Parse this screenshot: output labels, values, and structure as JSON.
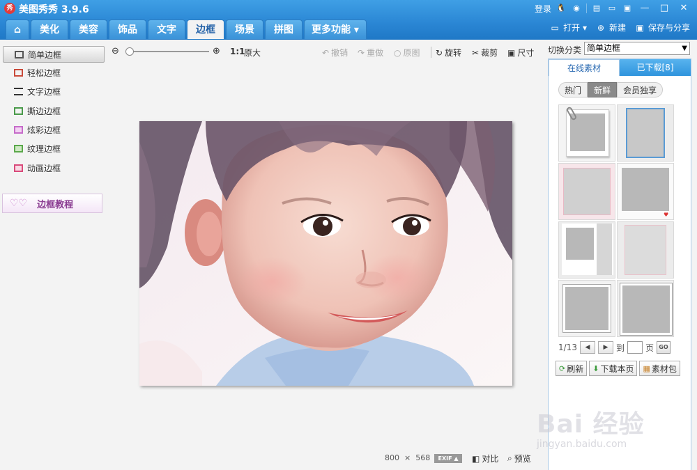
{
  "app": {
    "logo": "秀",
    "title": "美图秀秀 3.9.6"
  },
  "titlebar": {
    "login": "登录",
    "icons": [
      "qq-icon",
      "weibo-icon",
      "document-icon",
      "message-icon",
      "menu-icon"
    ],
    "minimize": "—",
    "maximize": "□",
    "close": "✕"
  },
  "tabs": [
    "",
    "美化",
    "美容",
    "饰品",
    "文字",
    "边框",
    "场景",
    "拼图",
    "更多功能 ▾"
  ],
  "active_tab": 5,
  "actions": {
    "open": "打开 ▾",
    "new": "新建",
    "save": "保存与分享"
  },
  "sidebar": {
    "items": [
      {
        "label": "简单边框"
      },
      {
        "label": "轻松边框"
      },
      {
        "label": "文字边框"
      },
      {
        "label": "撕边边框"
      },
      {
        "label": "炫彩边框"
      },
      {
        "label": "纹理边框"
      },
      {
        "label": "动画边框"
      }
    ],
    "tutorial": "边框教程"
  },
  "toolbar": {
    "ratio": "1:1",
    "ratio_label": "原大",
    "undo": "撤销",
    "redo": "重做",
    "original": "原图",
    "rotate": "旋转",
    "crop": "裁剪",
    "size": "尺寸"
  },
  "status": {
    "width": "800",
    "x": "×",
    "height": "568",
    "exif": "EXIF",
    "compare": "对比",
    "preview": "预览"
  },
  "right_panel": {
    "category_label": "切换分类",
    "category_value": "简单边框",
    "tab_online": "在线素材",
    "tab_downloaded": "已下载[8]",
    "sub_tabs": [
      "热门",
      "新鲜",
      "会员独享"
    ],
    "active_sub": 1,
    "page": "1/13",
    "goto_label": "到",
    "page_unit": "页",
    "go": "GO",
    "refresh": "刷新",
    "download_page": "下载本页",
    "material_pack": "素材包"
  },
  "watermark": {
    "main": "Bai 经验",
    "sub": "jingyan.baidu.com"
  },
  "colors": {
    "titlebar": "#2a86d4",
    "active_tab_text": "#1f5fa6",
    "tutorial": "#8b3d92"
  }
}
